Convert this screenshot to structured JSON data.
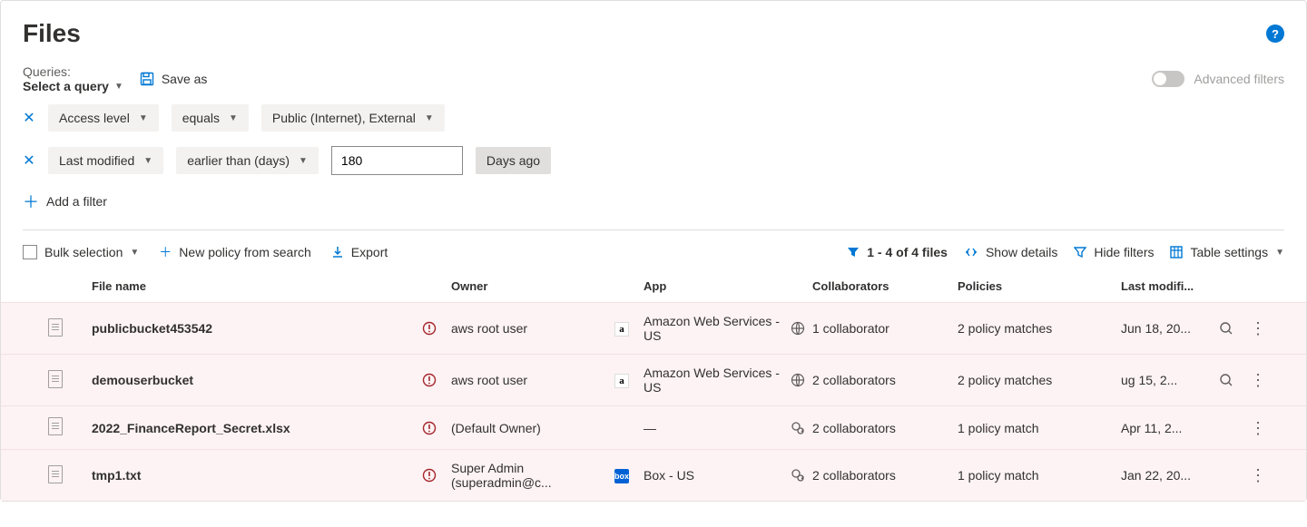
{
  "header": {
    "title": "Files"
  },
  "querybar": {
    "label": "Queries:",
    "select": "Select a query",
    "saveas": "Save as",
    "advanced": "Advanced filters"
  },
  "filters": {
    "rows": [
      {
        "field": "Access level",
        "op": "equals",
        "value": "Public (Internet), External",
        "value_editable": false,
        "suffix": ""
      },
      {
        "field": "Last modified",
        "op": "earlier than (days)",
        "value": "180",
        "value_editable": true,
        "suffix": "Days ago"
      }
    ],
    "add": "Add a filter"
  },
  "toolbar": {
    "bulk": "Bulk selection",
    "newpolicy": "New policy from search",
    "export": "Export",
    "count": "1 - 4 of 4 files",
    "showdetails": "Show details",
    "hidefilters": "Hide filters",
    "tablesettings": "Table settings"
  },
  "table": {
    "headers": {
      "fname": "File name",
      "owner": "Owner",
      "app": "App",
      "collab": "Collaborators",
      "pol": "Policies",
      "mod": "Last modifi..."
    },
    "rows": [
      {
        "fname": "publicbucket453542",
        "owner": "aws root user",
        "apptype": "aws",
        "app": "Amazon Web Services - US",
        "collabtype": "globe",
        "collab": "1 collaborator",
        "policies": "2 policy matches",
        "modified": "Jun 18, 20...",
        "search": true
      },
      {
        "fname": "demouserbucket",
        "owner": "aws root user",
        "apptype": "aws",
        "app": "Amazon Web Services - US",
        "collabtype": "globe",
        "collab": "2 collaborators",
        "policies": "2 policy matches",
        "modified": "ug 15, 2...",
        "search": true
      },
      {
        "fname": "2022_FinanceReport_Secret.xlsx",
        "owner": "(Default Owner)",
        "apptype": "",
        "app": "—",
        "collabtype": "share",
        "collab": "2 collaborators",
        "policies": "1 policy match",
        "modified": "Apr 11, 2...",
        "search": false
      },
      {
        "fname": "tmp1.txt",
        "owner": "Super Admin (superadmin@c...",
        "apptype": "box",
        "app": "Box - US",
        "collabtype": "share",
        "collab": "2 collaborators",
        "policies": "1 policy match",
        "modified": "Jan 22, 20...",
        "search": false
      }
    ]
  }
}
